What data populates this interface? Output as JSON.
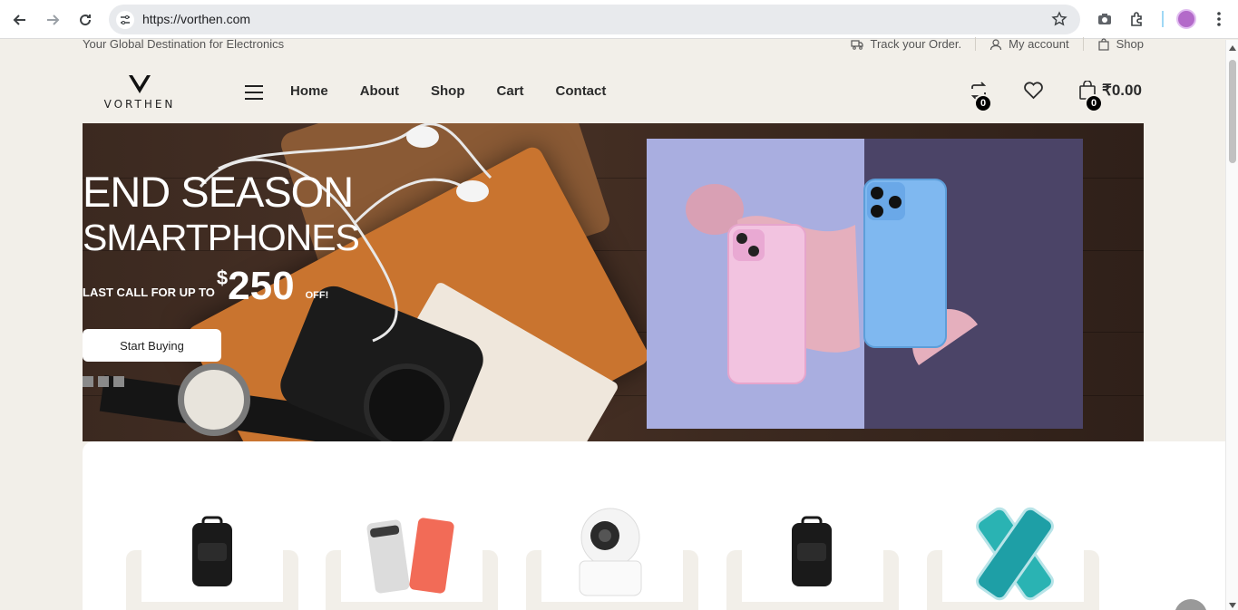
{
  "browser": {
    "url": "https://vorthen.com"
  },
  "topbar": {
    "tagline": "Your Global Destination for Electronics",
    "links": [
      {
        "label": "Track your Order.",
        "icon": "truck-icon"
      },
      {
        "label": "My account",
        "icon": "user-icon"
      },
      {
        "label": "Shop",
        "icon": "bag-icon"
      }
    ]
  },
  "header": {
    "logo_text": "VORTHEN",
    "nav": [
      "Home",
      "About",
      "Shop",
      "Cart",
      "Contact"
    ],
    "compare_count": "0",
    "cart_count": "0",
    "cart_total": "₹0.00"
  },
  "hero": {
    "title_line1": "END SEASON",
    "title_line2": "SMARTPHONES",
    "offer_prefix": "LAST CALL FOR UP TO",
    "offer_currency": "$",
    "offer_amount": "250",
    "offer_suffix": "OFF!",
    "button_label": "Start Buying",
    "slide_count": 3
  },
  "products": [
    {
      "name": "backpack"
    },
    {
      "name": "pixel-phones"
    },
    {
      "name": "security-camera"
    },
    {
      "name": "backpack"
    },
    {
      "name": "phone-case"
    }
  ],
  "colors": {
    "page_bg": "#f2efe9",
    "text_dark": "#2b2b2b",
    "accent_badge": "#000000"
  }
}
